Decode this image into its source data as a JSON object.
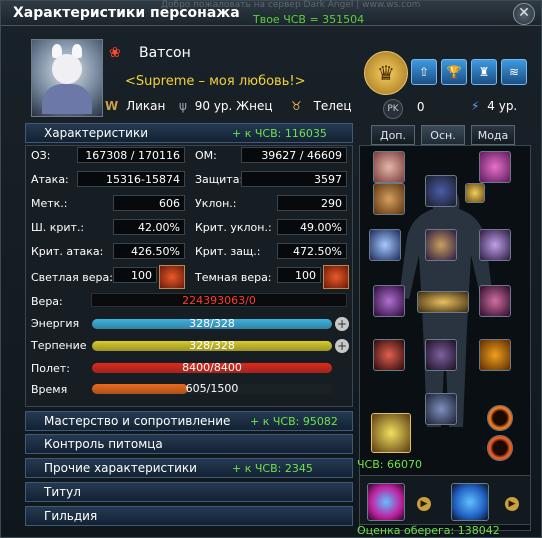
{
  "window": {
    "title": "Характеристики персонажа",
    "top_note": "Добро пожаловать на сервер Dark Angel | www.ws.com",
    "chsv_label": "Твое ЧСВ = 351504",
    "close_label": "✕"
  },
  "character": {
    "name": "Ватсон",
    "guild_title": "<Supreme – моя любовь!>",
    "race": "Ликан",
    "level_class": "90 ур. Жнец",
    "zodiac": "Телец",
    "pk": "0",
    "rebirth": "4 ур."
  },
  "sections": {
    "stats": {
      "label": "Характеристики",
      "bonus": "+ к ЧСВ: 116035"
    },
    "mastery": {
      "label": "Мастерство и сопротивление",
      "bonus": "+ к ЧСВ: 95082"
    },
    "pet": {
      "label": "Контроль питомца"
    },
    "other": {
      "label": "Прочие характеристики",
      "bonus": "+ к ЧСВ: 2345"
    },
    "titles": {
      "label": "Титул"
    },
    "guild": {
      "label": "Гильдия"
    }
  },
  "stats": {
    "hp": {
      "label": "ОЗ:",
      "value": "167308 / 170116"
    },
    "mp": {
      "label": "ОМ:",
      "value": "39627 / 46609"
    },
    "attack": {
      "label": "Атака:",
      "value": "15316-15874"
    },
    "defense": {
      "label": "Защита:",
      "value": "3597"
    },
    "accuracy": {
      "label": "Метк.:",
      "value": "606"
    },
    "evasion": {
      "label": "Уклон.:",
      "value": "290"
    },
    "crit_chance": {
      "label": "Ш. крит.:",
      "value": "42.00%"
    },
    "crit_evasion": {
      "label": "Крит. уклон.:",
      "value": "49.00%"
    },
    "crit_attack": {
      "label": "Крит. атака:",
      "value": "426.50%"
    },
    "crit_defense": {
      "label": "Крит. защ.:",
      "value": "472.50%"
    },
    "light_faith": {
      "label": "Светлая вера:",
      "value": "100"
    },
    "dark_faith": {
      "label": "Темная вера:",
      "value": "100"
    }
  },
  "bars": {
    "faith": {
      "label": "Вера:",
      "value": "224393063/0",
      "fill": 0
    },
    "energy": {
      "label": "Энергия",
      "value": "328/328",
      "fill": 1.0,
      "color": "#3fb2e0"
    },
    "patience": {
      "label": "Терпение",
      "value": "328/328",
      "fill": 1.0,
      "color": "#d9cc2a"
    },
    "flight": {
      "label": "Полет:",
      "value": "8400/8400",
      "fill": 1.0,
      "color": "#e0281a"
    },
    "time": {
      "label": "Время",
      "value": "605/1500",
      "fill": 0.4033,
      "color": "#ee6a1a"
    }
  },
  "tabs": [
    {
      "label": "Доп."
    },
    {
      "label": "Осн."
    },
    {
      "label": "Мода"
    }
  ],
  "equipment": {
    "chsv_note": "ЧСВ: 66070",
    "charm_note": "Оценка оберега: 138042"
  },
  "colors": {
    "accent_green": "#6ee24a",
    "title_gold": "#f2d239",
    "panel_border": "#3a4751"
  }
}
